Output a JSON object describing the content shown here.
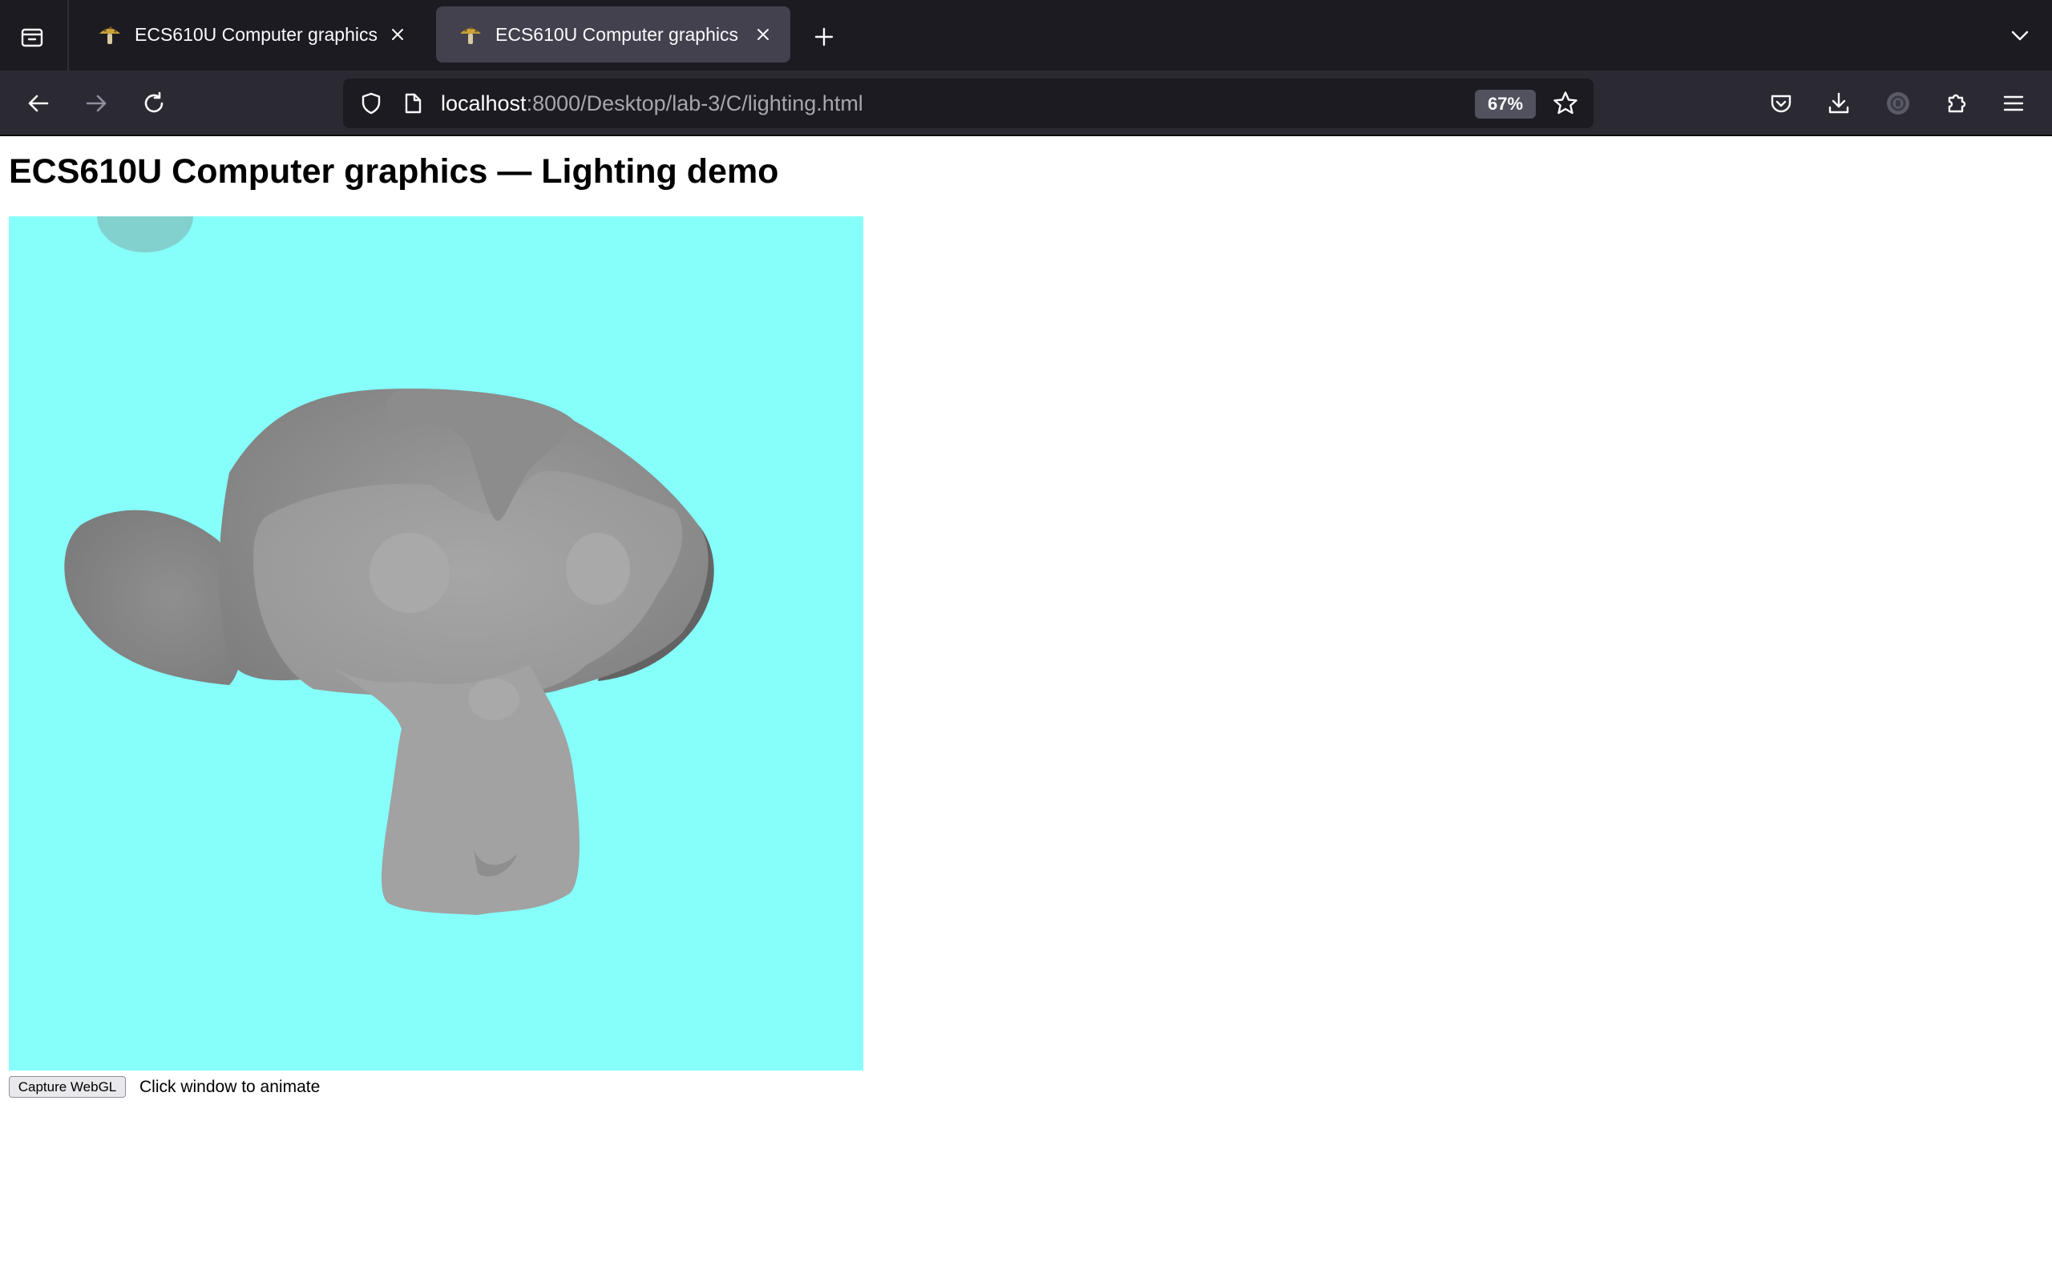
{
  "browser": {
    "tabs": [
      {
        "title": "ECS610U Computer graphics",
        "active": false
      },
      {
        "title": "ECS610U Computer graphics",
        "active": true
      }
    ],
    "url": {
      "host": "localhost",
      "rest": ":8000/Desktop/lab-3/C/lighting.html"
    },
    "zoom": "67%"
  },
  "page": {
    "heading": "ECS610U Computer graphics — Lighting demo",
    "canvas_background": "#86fffb",
    "capture_label": "Capture WebGL",
    "hint": "Click window to animate"
  },
  "colors": {
    "tabbar_bg": "#1c1b22",
    "navbar_bg": "#2b2a33",
    "urlbar_bg": "#1c1b22",
    "active_tab_bg": "#42414d",
    "icon": "#fbfbfe",
    "url_path": "#a6a6ae"
  }
}
